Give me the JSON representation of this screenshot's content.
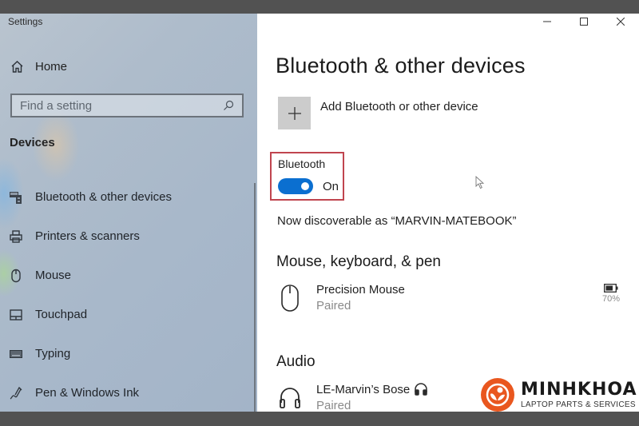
{
  "window": {
    "app_title": "Settings",
    "controls": {
      "minimize_icon": "minimize-icon",
      "maximize_icon": "maximize-icon",
      "close_icon": "close-icon"
    }
  },
  "sidebar": {
    "home_label": "Home",
    "home_icon": "home-icon",
    "search": {
      "placeholder": "Find a setting",
      "value": "",
      "icon": "search-icon"
    },
    "section_heading": "Devices",
    "items": [
      {
        "label": "Bluetooth & other devices",
        "icon": "bluetooth-devices-icon"
      },
      {
        "label": "Printers & scanners",
        "icon": "printer-icon"
      },
      {
        "label": "Mouse",
        "icon": "mouse-icon"
      },
      {
        "label": "Touchpad",
        "icon": "touchpad-icon"
      },
      {
        "label": "Typing",
        "icon": "keyboard-icon"
      },
      {
        "label": "Pen & Windows Ink",
        "icon": "pen-icon"
      }
    ]
  },
  "main": {
    "page_title": "Bluetooth & other devices",
    "add_device": {
      "label": "Add Bluetooth or other device",
      "icon": "plus-icon"
    },
    "bluetooth": {
      "label": "Bluetooth",
      "state_label": "On",
      "enabled": true,
      "highlight_color": "#c0454f",
      "toggle_color": "#0b6fd0"
    },
    "discoverable_text": "Now discoverable as “MARVIN-MATEBOOK”",
    "groups": [
      {
        "title": "Mouse, keyboard, & pen",
        "devices": [
          {
            "name": "Precision Mouse",
            "status": "Paired",
            "icon": "mouse-icon",
            "battery_percent": "70%",
            "battery_icon": "battery-icon"
          }
        ]
      },
      {
        "title": "Audio",
        "devices": [
          {
            "name": "LE-Marvin’s Bose",
            "status": "Paired",
            "icon": "headphones-icon",
            "name_badge_icon": "headphones-small-icon"
          }
        ]
      }
    ]
  },
  "watermark": {
    "brand_name": "MINHKHOA",
    "tagline": "LAPTOP PARTS & SERVICES",
    "brand_color": "#e9571f"
  }
}
